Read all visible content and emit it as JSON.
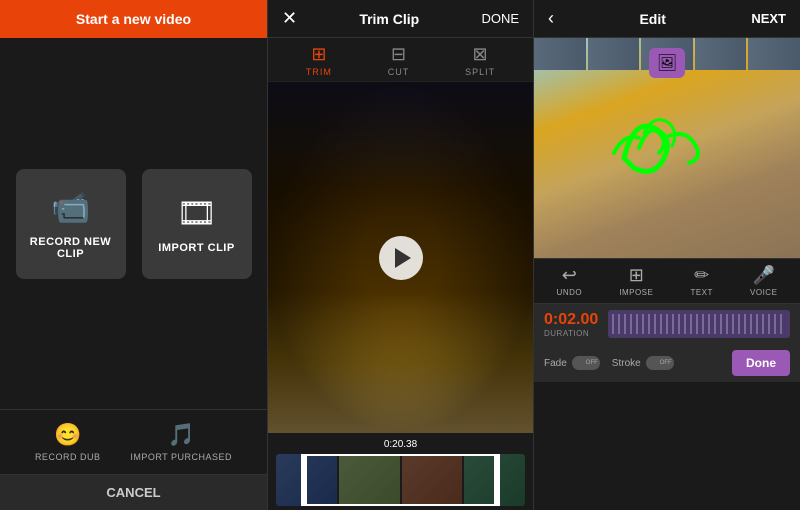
{
  "panel1": {
    "header": "Start a new video",
    "record_btn_label": "RECORD NEW CLIP",
    "import_btn_label": "IMPORT CLIP",
    "record_dub_label": "RECORD DUB",
    "import_purchased_label": "IMPORT PURCHASED",
    "cancel_label": "CANCEL"
  },
  "panel2": {
    "header": "Trim Clip",
    "done_label": "DONE",
    "tab_trim": "TRIM",
    "tab_cut": "CUT",
    "tab_split": "SPLIT",
    "timestamp": "0:20.38"
  },
  "panel3": {
    "header": "Edit",
    "next_label": "NEXT",
    "tool_undo": "UNDO",
    "tool_impose": "IMPOSE",
    "tool_text": "TEXT",
    "tool_voice": "VOICE",
    "duration_time": "0:02.00",
    "duration_label": "DURATION",
    "fade_label": "Fade",
    "fade_state": "OFF",
    "stroke_label": "Stroke",
    "stroke_state": "OFF",
    "done_label": "Done"
  }
}
